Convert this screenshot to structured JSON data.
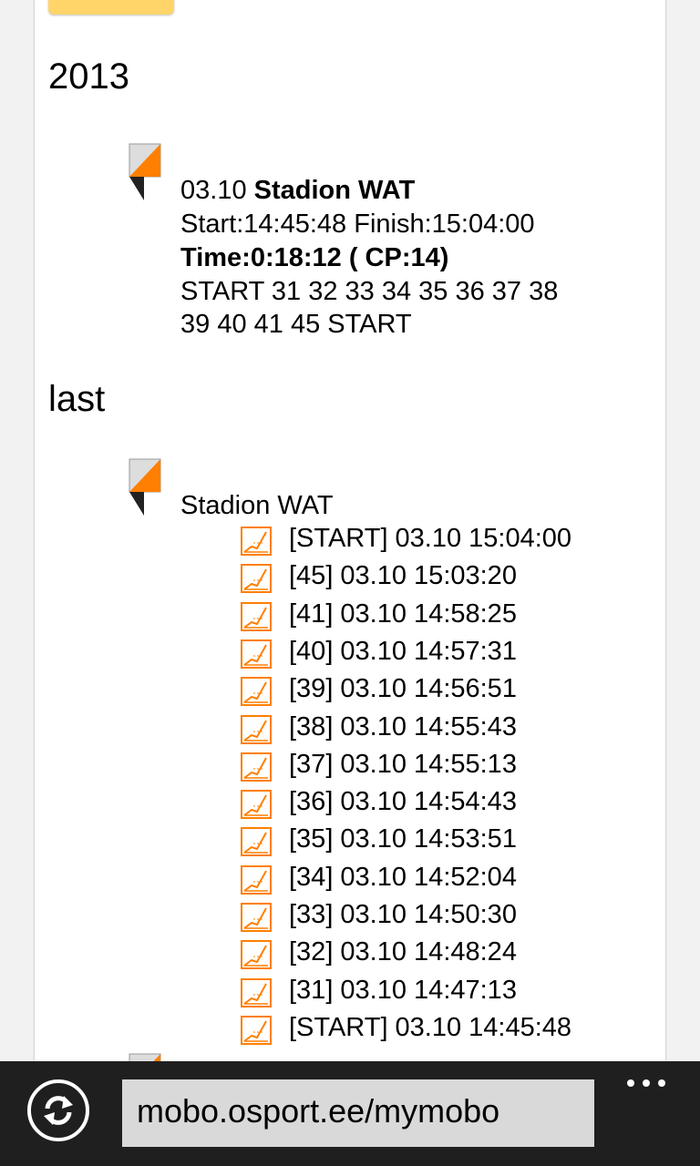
{
  "section_year": "2013",
  "entry": {
    "date": "03.10",
    "name": "Stadion WAT",
    "start_finish": "Start:14:45:48 Finish:15:04:00",
    "time_cp": "Time:0:18:12 ( CP:14)",
    "route_line1": "START 31 32 33 34 35 36 37 38",
    "route_line2": "39 40 41 45 START"
  },
  "section_last": "last",
  "last_entry": {
    "name": "Stadion WAT",
    "punches": [
      "[START] 03.10 15:04:00",
      "[45] 03.10 15:03:20",
      "[41] 03.10 14:58:25",
      "[40] 03.10 14:57:31",
      "[39] 03.10 14:56:51",
      "[38] 03.10 14:55:43",
      "[37] 03.10 14:55:13",
      "[36] 03.10 14:54:43",
      "[35] 03.10 14:53:51",
      "[34] 03.10 14:52:04",
      "[33] 03.10 14:50:30",
      "[32] 03.10 14:48:24",
      "[31] 03.10 14:47:13",
      "[START] 03.10 14:45:48"
    ]
  },
  "browser": {
    "address": "mobo.osport.ee/mymobo",
    "refresh_icon": "refresh-icon",
    "more_icon": "more-dots-icon"
  },
  "colors": {
    "accent_orange": "#ff7f00",
    "button_yellow": "#ffd56a",
    "appbar_bg": "#1f1f1f"
  }
}
